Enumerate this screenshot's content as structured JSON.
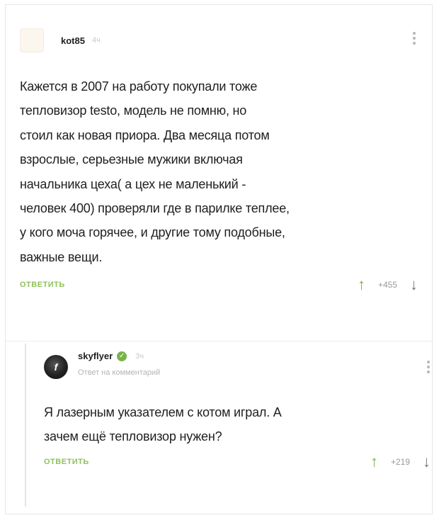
{
  "comment1": {
    "username": "kot85",
    "time": "4ч",
    "lines": [
      "Кажется в 2007 на работу покупали тоже",
      "тепловизор testo, модель не помню, но",
      "стоил как новая приора. Два месяца потом",
      "взрослые, серьезные мужики включая",
      "начальника цеха( а цех не маленький -",
      "человек 400) проверяли где в парилке теплее,",
      "у кого моча горячее, и другие тому подобные,",
      "важные вещи."
    ],
    "reply_label": "ОТВЕТИТЬ",
    "score": "+455"
  },
  "comment2": {
    "username": "skyflyer",
    "time": "3ч",
    "reply_to": "Ответ на комментарий",
    "lines": [
      "Я лазерным указателем с котом играл. А",
      "зачем ещё тепловизор нужен?"
    ],
    "reply_label": "ОТВЕТИТЬ",
    "score": "+219"
  },
  "icons": {
    "upvote": "↑",
    "downvote": "↓",
    "verified": "✓",
    "avatar2_letter": "f"
  },
  "colors": {
    "accent_green": "#7ab34a",
    "reply_green": "#8fc15b",
    "muted": "#9a9a9a"
  }
}
